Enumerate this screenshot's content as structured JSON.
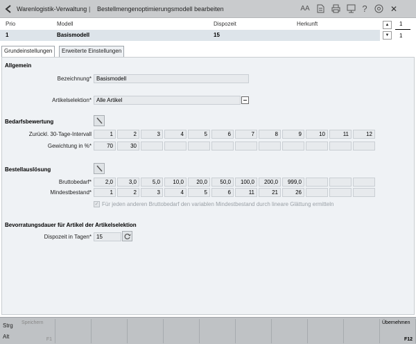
{
  "titlebar": {
    "crumb1": "Warenlogistik-Verwaltung",
    "separator": "|",
    "crumb2": "Bestellmengenoptimierungsmodell bearbeiten",
    "font_icon_label": "AA",
    "help_label": "?",
    "close_label": "✕"
  },
  "table": {
    "headers": {
      "prio": "Prio",
      "modell": "Modell",
      "dispozeit": "Dispozeit",
      "herkunft": "Herkunft"
    },
    "row": {
      "prio": "1",
      "modell": "Basismodell",
      "dispozeit": "15",
      "herkunft": ""
    },
    "page_current": "1",
    "page_total": "1"
  },
  "tabs": [
    "Grundeinstellungen",
    "Erweiterte Einstellungen"
  ],
  "allgemein": {
    "section": "Allgemein",
    "bezeichnung_label": "Bezeichnung*",
    "bezeichnung_value": "Basismodell",
    "artikel_label": "Artikelselektion*",
    "artikel_value": "Alle Artikel"
  },
  "bedarf": {
    "section": "Bedarfsbewertung",
    "row1_label": "Zurückl. 30-Tage-Intervall",
    "row1": [
      "1",
      "2",
      "3",
      "4",
      "5",
      "6",
      "7",
      "8",
      "9",
      "10",
      "11",
      "12"
    ],
    "row2_label": "Gewichtung in %*",
    "row2": [
      "70",
      "30",
      "",
      "",
      "",
      "",
      "",
      "",
      "",
      "",
      "",
      ""
    ]
  },
  "bestell": {
    "section": "Bestellauslösung",
    "row1_label": "Bruttobedarf*",
    "row1": [
      "2,0",
      "3,0",
      "5,0",
      "10,0",
      "20,0",
      "50,0",
      "100,0",
      "200,0",
      "999,0",
      "",
      "",
      ""
    ],
    "row2_label": "Mindestbestand*",
    "row2": [
      "1",
      "2",
      "3",
      "4",
      "5",
      "6",
      "11",
      "21",
      "26",
      "",
      "",
      ""
    ],
    "checkbox_label": "Für jeden anderen Bruttobedarf den variablen Mindestbestand durch lineare Glättung ermitteln",
    "checkbox_checked": true
  },
  "bevorratung": {
    "section": "Bevorratungsdauer für Artikel der Artikelselektion",
    "label": "Dispozeit in Tagen*",
    "value": "15"
  },
  "footer": {
    "strg": "Strg",
    "alt": "Alt",
    "keys": [
      {
        "label": "Speichern",
        "key": "F1",
        "enabled": false
      },
      {
        "label": "",
        "key": "",
        "enabled": false
      },
      {
        "label": "",
        "key": "",
        "enabled": false
      },
      {
        "label": "",
        "key": "",
        "enabled": false
      },
      {
        "label": "",
        "key": "",
        "enabled": false
      },
      {
        "label": "",
        "key": "",
        "enabled": false
      },
      {
        "label": "",
        "key": "",
        "enabled": false
      },
      {
        "label": "",
        "key": "",
        "enabled": false
      },
      {
        "label": "",
        "key": "",
        "enabled": false
      },
      {
        "label": "",
        "key": "",
        "enabled": false
      },
      {
        "label": "Übernehmen",
        "key": "F12",
        "enabled": true
      }
    ]
  }
}
